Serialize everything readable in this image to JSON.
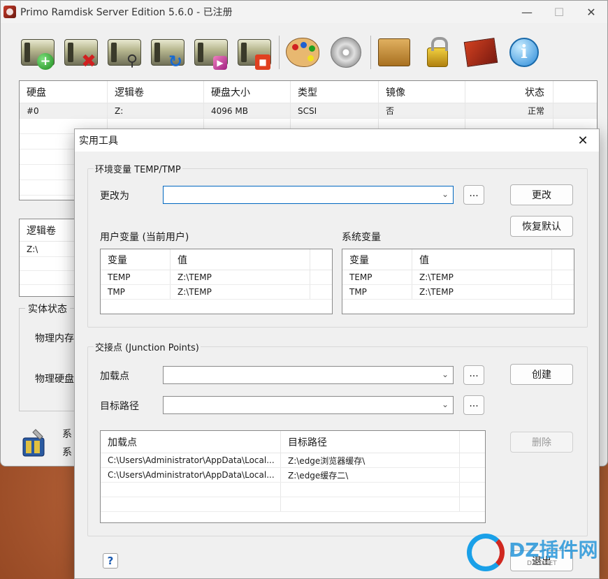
{
  "window": {
    "title": "Primo Ramdisk Server Edition 5.6.0 - 已注册"
  },
  "disk_table": {
    "columns": [
      "硬盘",
      "逻辑卷",
      "硬盘大小",
      "类型",
      "镜像",
      "状态"
    ],
    "rows": [
      {
        "disk": "#0",
        "volume": "Z:",
        "size": "4096 MB",
        "type": "SCSI",
        "mirror": "否",
        "status": "正常"
      }
    ]
  },
  "lv_panel": {
    "header": "逻辑卷",
    "row": "Z:\\"
  },
  "entity_group": {
    "legend": "实体状态",
    "mem": "物理内存",
    "disk": "物理硬盘"
  },
  "sys_text": {
    "line1": "系",
    "line2": "系"
  },
  "dialog": {
    "title": "实用工具",
    "env": {
      "legend": "环境变量 TEMP/TMP",
      "change_to_label": "更改为",
      "change_to_value": "",
      "browse": "...",
      "change_btn": "更改",
      "restore_btn": "恢复默认",
      "user_label": "用户变量 (当前用户)",
      "system_label": "系统变量",
      "col_var": "变量",
      "col_val": "值",
      "user_rows": [
        {
          "var": "TEMP",
          "val": "Z:\\TEMP"
        },
        {
          "var": "TMP",
          "val": "Z:\\TEMP"
        }
      ],
      "system_rows": [
        {
          "var": "TEMP",
          "val": "Z:\\TEMP"
        },
        {
          "var": "TMP",
          "val": "Z:\\TEMP"
        }
      ]
    },
    "junction": {
      "legend": "交接点 (Junction Points)",
      "mount_label": "加载点",
      "target_label": "目标路径",
      "mount_value": "",
      "target_value": "",
      "browse": "...",
      "create_btn": "创建",
      "delete_btn": "删除",
      "col_mount": "加载点",
      "col_target": "目标路径",
      "rows": [
        {
          "mount": "C:\\Users\\Administrator\\AppData\\Local...",
          "target": "Z:\\edge浏览器缓存\\"
        },
        {
          "mount": "C:\\Users\\Administrator\\AppData\\Local...",
          "target": "Z:\\edge缓存二\\"
        }
      ]
    },
    "help": "?",
    "exit_btn": "退出"
  },
  "watermark": {
    "text": "DZ插件网",
    "sub": "DZ-X.NET"
  }
}
